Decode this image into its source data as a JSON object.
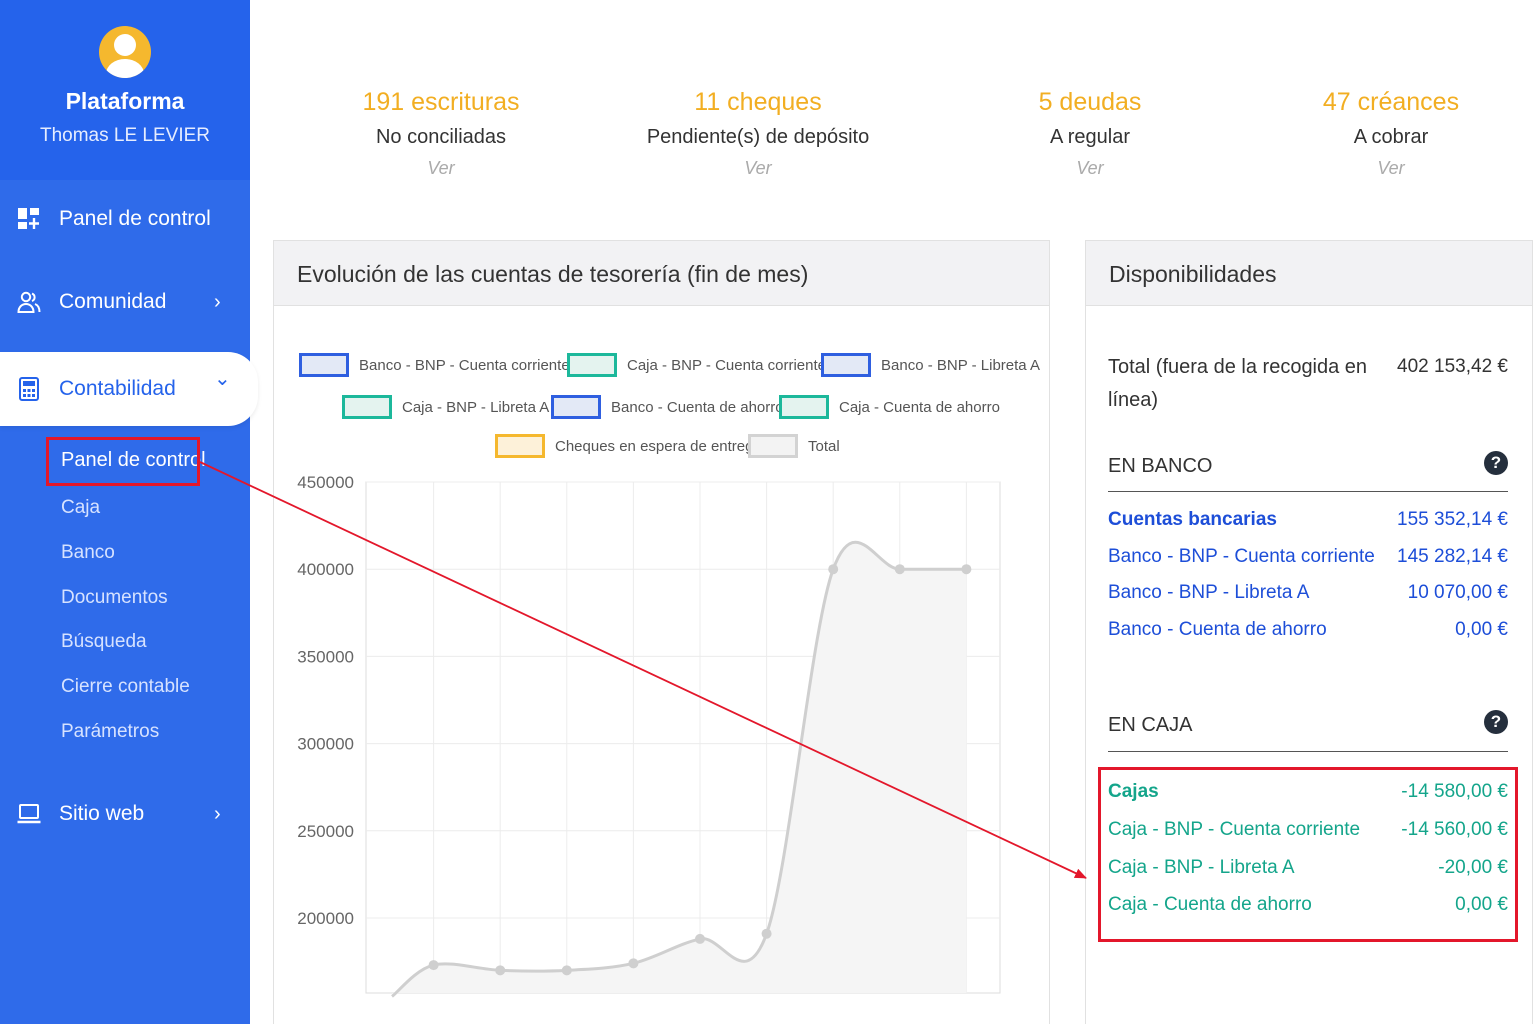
{
  "profile": {
    "platform": "Plataforma",
    "user": "Thomas LE LEVIER",
    "avatar_icon": "user-avatar-icon"
  },
  "nav": {
    "panel": "Panel de control",
    "comunidad": "Comunidad",
    "contabilidad": "Contabilidad",
    "sitio": "Sitio web",
    "chevron_right": "›",
    "chevron_down": "⌄",
    "sub": [
      "Panel de control",
      "Caja",
      "Banco",
      "Documentos",
      "Búsqueda",
      "Cierre contable",
      "Parámetros"
    ]
  },
  "stats": [
    {
      "value": "191 escrituras",
      "desc": "No conciliadas",
      "link": "Ver"
    },
    {
      "value": "11 cheques",
      "desc": "Pendiente(s) de depósito",
      "link": "Ver"
    },
    {
      "value": "5 deudas",
      "desc": "A regular",
      "link": "Ver"
    },
    {
      "value": "47 créances",
      "desc": "A cobrar",
      "link": "Ver"
    }
  ],
  "chart_panel": {
    "title": "Evolución de las cuentas de tesorería (fin de mes)"
  },
  "chart_data": {
    "type": "line",
    "x": [
      1,
      2,
      3,
      4,
      5,
      6,
      7,
      8,
      9,
      10
    ],
    "ylim": [
      155000,
      450000
    ],
    "y_ticks": [
      "450000",
      "400000",
      "350000",
      "300000",
      "250000",
      "200000"
    ],
    "grid": true,
    "legend_position": "top",
    "legend": [
      {
        "label": "Banco - BNP - Cuenta corriente",
        "color": "#2f5fe0"
      },
      {
        "label": "Caja - BNP - Cuenta corriente",
        "color": "#1cb89b"
      },
      {
        "label": "Banco - BNP - Libreta A",
        "color": "#2f5fe0"
      },
      {
        "label": "Caja - BNP - Libreta A",
        "color": "#1cb89b"
      },
      {
        "label": "Banco - Cuenta de ahorro",
        "color": "#2f5fe0"
      },
      {
        "label": "Caja - Cuenta de ahorro",
        "color": "#1cb89b"
      },
      {
        "label": "Cheques en espera de entrega",
        "color": "#f5b82e"
      },
      {
        "label": "Total",
        "color": "#cccccc"
      }
    ],
    "series": [
      {
        "name": "Total",
        "values": [
          155000,
          173000,
          170000,
          170000,
          174000,
          188000,
          191000,
          400000,
          400000,
          400000
        ]
      }
    ]
  },
  "dispo": {
    "title": "Disponibilidades",
    "total_label_1": "Total (fuera de la recogida en",
    "total_label_2": "línea)",
    "total_value": "402 153,42 €",
    "banco_head": "EN BANCO",
    "caja_head": "EN CAJA",
    "help": "?",
    "banco_rows": [
      {
        "label": "Cuentas bancarias",
        "value": "155 352,14 €"
      },
      {
        "label": "Banco - BNP - Cuenta corriente",
        "value": "145 282,14 €"
      },
      {
        "label": "Banco - BNP - Libreta A",
        "value": "10 070,00 €"
      },
      {
        "label": "Banco - Cuenta de ahorro",
        "value": "0,00 €"
      }
    ],
    "caja_rows": [
      {
        "label": "Cajas",
        "value": "-14 580,00 €"
      },
      {
        "label": "Caja - BNP - Cuenta corriente",
        "value": "-14 560,00 €"
      },
      {
        "label": "Caja - BNP - Libreta A",
        "value": "-20,00 €"
      },
      {
        "label": "Caja - Cuenta de ahorro",
        "value": "0,00 €"
      }
    ]
  },
  "colors": {
    "sidebar": "#2f6bea",
    "accent": "#f2ae22",
    "highlight": "#e3172b",
    "bank": "#1d4ed8",
    "cash": "#14a58b"
  }
}
